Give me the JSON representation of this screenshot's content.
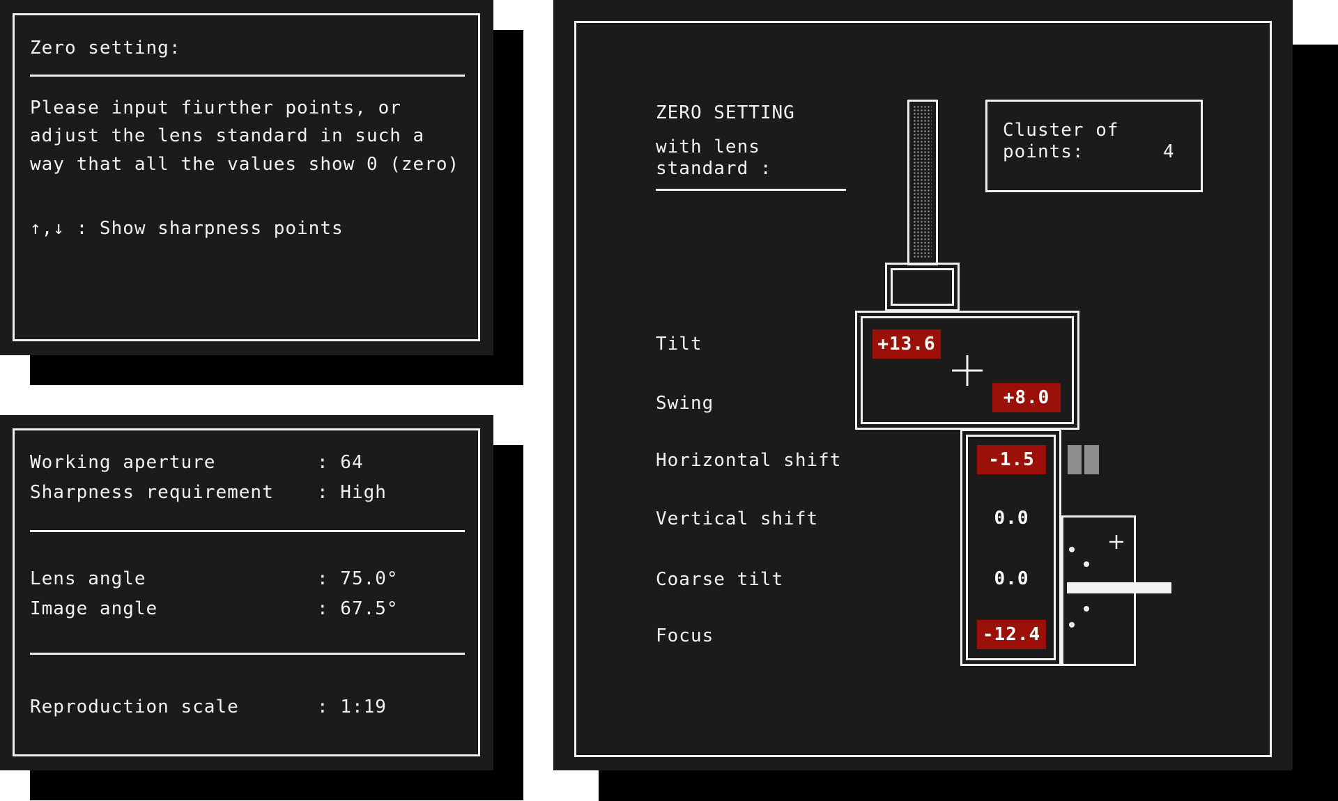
{
  "info_panel": {
    "title": "Zero setting:",
    "lines": [
      "Please input fiurther points, or",
      "adjust the lens standard in such a",
      "way that all the values show 0 (zero)"
    ],
    "hint": "↑,↓ : Show sharpness points"
  },
  "params_panel": {
    "rows": [
      {
        "label": "Working aperture",
        "value": ": 64"
      },
      {
        "label": "Sharpness requirement",
        "value": ": High"
      },
      {
        "label": "Lens angle",
        "value": ": 75.0°"
      },
      {
        "label": "Image angle",
        "value": ": 67.5°"
      },
      {
        "label": "Reproduction scale",
        "value": ": 1:19"
      }
    ]
  },
  "main_panel": {
    "heading": "ZERO SETTING",
    "subheading_line1": "with lens",
    "subheading_line2": "standard :",
    "cluster_label_line1": "Cluster of",
    "cluster_label_line2": "points:",
    "cluster_value": "4",
    "labels": {
      "tilt": "Tilt",
      "swing": "Swing",
      "horizontal_shift": "Horizontal shift",
      "vertical_shift": "Vertical shift",
      "coarse_tilt": "Coarse tilt",
      "focus": "Focus"
    },
    "values": {
      "tilt": "+13.6",
      "swing": "+8.0",
      "horizontal_shift": "-1.5",
      "vertical_shift": "0.0",
      "coarse_tilt": "0.0",
      "focus": "-12.4"
    },
    "colors": {
      "alert": "#9b1109",
      "panel": "#1b1b1b",
      "line": "#f2f2f2"
    }
  }
}
